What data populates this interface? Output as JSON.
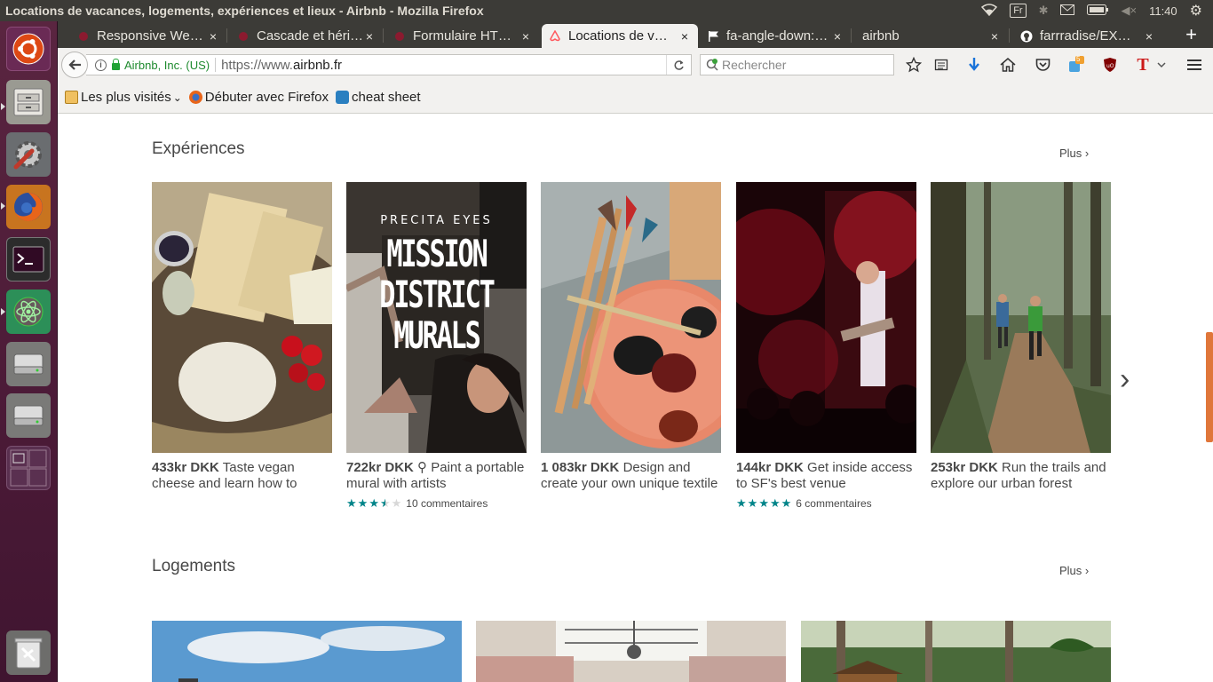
{
  "panel": {
    "window_title": "Locations de vacances, logements, expériences et lieux - Airbnb - Mozilla Firefox",
    "keyboard": "Fr",
    "clock": "11:40"
  },
  "launcher": [
    "ubuntu-dash",
    "files",
    "system-settings",
    "firefox",
    "terminal",
    "atom",
    "drive-1",
    "drive-2",
    "workspaces",
    "trash"
  ],
  "tabs": [
    {
      "label": "Responsive We…",
      "icon": "responsive-tab-icon",
      "color": "#8b1a2f"
    },
    {
      "label": "Cascade et héri…",
      "icon": "cascade-tab-icon",
      "color": "#8b1a2f"
    },
    {
      "label": "Formulaire HT…",
      "icon": "formulaire-tab-icon",
      "color": "#8b1a2f"
    },
    {
      "label": "Locations de v…",
      "icon": "airbnb-tab-icon",
      "color": "#ff5a5f"
    },
    {
      "label": "fa-angle-down:…",
      "icon": "flag-tab-icon",
      "color": "#222"
    },
    {
      "label": "airbnb",
      "icon": "",
      "color": ""
    },
    {
      "label": "farrradise/EX…",
      "icon": "github-tab-icon",
      "color": "#222"
    }
  ],
  "close_glyph": "×",
  "new_tab": "+",
  "nav": {
    "org": "Airbnb, Inc. (US)",
    "url_prefix": "https://www.",
    "url_host": "airbnb.fr",
    "search_placeholder": "Rechercher",
    "badge_count": "5"
  },
  "bookmarks": [
    {
      "label": "Les plus visités",
      "dropdown": "⌄"
    },
    {
      "label": "Débuter avec Firefox"
    },
    {
      "label": "cheat sheet"
    }
  ],
  "experiences": {
    "title": "Expériences",
    "more": "Plus",
    "next": "›",
    "cards": [
      {
        "price": "433kr DKK",
        "badge": "",
        "text": "Taste vegan cheese and learn how to",
        "rating": 0,
        "reviews": ""
      },
      {
        "price": "722kr DKK",
        "badge": "⚲",
        "text": "Paint a portable mural with artists",
        "rating": 3.5,
        "reviews": "10 commentaires"
      },
      {
        "price": "1 083kr DKK",
        "badge": "",
        "text": "Design and create your own unique textile",
        "rating": 0,
        "reviews": ""
      },
      {
        "price": "144kr DKK",
        "badge": "",
        "text": "Get inside access to SF's best venue",
        "rating": 5,
        "reviews": "6 commentaires"
      },
      {
        "price": "253kr DKK",
        "badge": "",
        "text": "Run the trails and explore our urban forest",
        "rating": 0,
        "reviews": ""
      }
    ],
    "mural_poster": {
      "line1": "PRECITA EYES",
      "line2": "MISSION",
      "line3": "DISTRICT",
      "line4": "MURALS"
    }
  },
  "homes": {
    "title": "Logements",
    "more": "Plus"
  },
  "colors": {
    "star": "#008489",
    "text": "#484848",
    "secure": "#1e8a2e",
    "ubuntu_launcher": "#4b1a37"
  }
}
